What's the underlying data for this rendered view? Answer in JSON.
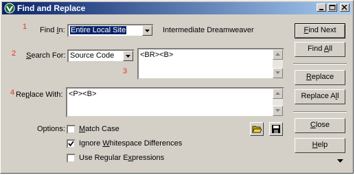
{
  "window": {
    "title": "Find and Replace"
  },
  "annotations": {
    "n1": "1",
    "n2": "2",
    "n3": "3",
    "n4": "4"
  },
  "find_in": {
    "label_pre": "Find ",
    "label_u": "I",
    "label_post": "n:",
    "value": "Entire Local Site",
    "site_name": "Intermediate Dreamweaver"
  },
  "search_for": {
    "label_pre": "",
    "label_u": "S",
    "label_post": "earch For:",
    "value": "Source Code",
    "text": "<BR><B>"
  },
  "replace_with": {
    "label_pre": "Re",
    "label_u": "p",
    "label_post": "lace With:",
    "text": "<P><B>"
  },
  "options": {
    "label": "Options:",
    "match_case": {
      "pre": "",
      "u": "M",
      "post": "atch Case",
      "checked": false
    },
    "ignore_ws": {
      "pre": "Ignore ",
      "u": "W",
      "post": "hitespace Differences",
      "checked": true
    },
    "regex": {
      "pre": "Use Regular E",
      "u": "x",
      "post": "pressions",
      "checked": false
    }
  },
  "buttons": {
    "find_next": {
      "pre": "",
      "u": "F",
      "post": "ind Next"
    },
    "find_all": {
      "pre": "Find ",
      "u": "A",
      "post": "ll"
    },
    "replace": {
      "pre": "",
      "u": "R",
      "post": "eplace"
    },
    "replace_all": {
      "pre": "Replace A",
      "u": "l",
      "post": "l"
    },
    "close": {
      "pre": "",
      "u": "C",
      "post": "lose"
    },
    "help": {
      "pre": "",
      "u": "H",
      "post": "elp"
    }
  },
  "icons": {
    "open": "open-folder-icon",
    "save": "floppy-disk-icon",
    "more": "triangle-down-icon"
  },
  "colors": {
    "title_start": "#0a246a",
    "title_end": "#a6caf0",
    "annotation": "#e0302a",
    "face": "#d4d0c8"
  }
}
